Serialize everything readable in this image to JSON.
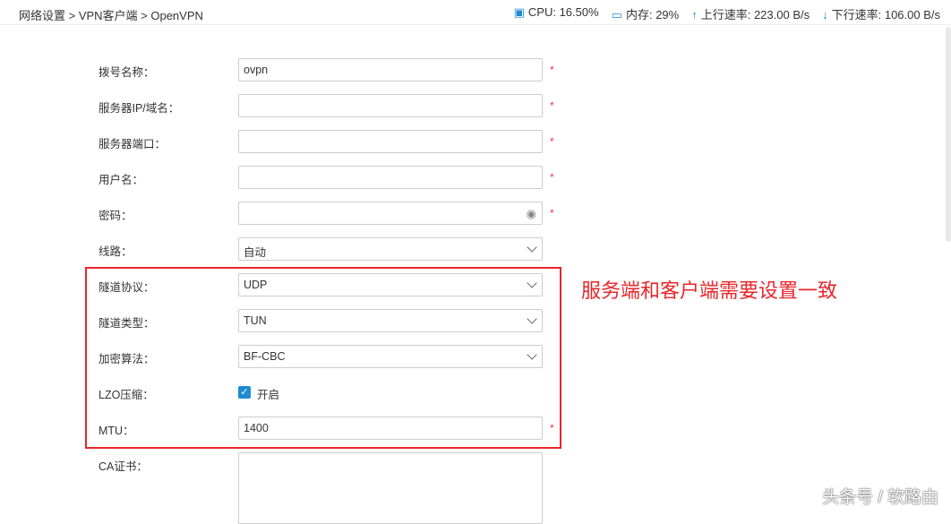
{
  "breadcrumb": "网络设置 > VPN客户端 > OpenVPN",
  "stats": {
    "cpu": "CPU: 16.50%",
    "mem": "内存: 29%",
    "up": "上行速率: 223.00 B/s",
    "down": "下行速率: 106.00 B/s"
  },
  "form": [
    {
      "label": "拨号名称：",
      "value": "ovpn",
      "required": true
    },
    {
      "label": "服务器IP/域名：",
      "value": "",
      "required": true
    },
    {
      "label": "服务器端口：",
      "value": "",
      "required": true
    },
    {
      "label": "用户名：",
      "value": "",
      "required": true
    },
    {
      "label": "密码：",
      "value": "",
      "required": true
    },
    {
      "label": "线路：",
      "value": "自动"
    },
    {
      "label": "隧道协议：",
      "value": "UDP"
    },
    {
      "label": "隧道类型：",
      "value": "TUN"
    },
    {
      "label": "加密算法：",
      "value": "BF-CBC"
    },
    {
      "label": "LZO压缩：",
      "value": "开启",
      "checked": true
    },
    {
      "label": "MTU：",
      "value": "1400",
      "required": true
    },
    {
      "label": "CA证书：",
      "value": ""
    }
  ],
  "star": "*",
  "annotation": "服务端和客户端需要设置一致",
  "watermark": "头条号 / 软路由"
}
